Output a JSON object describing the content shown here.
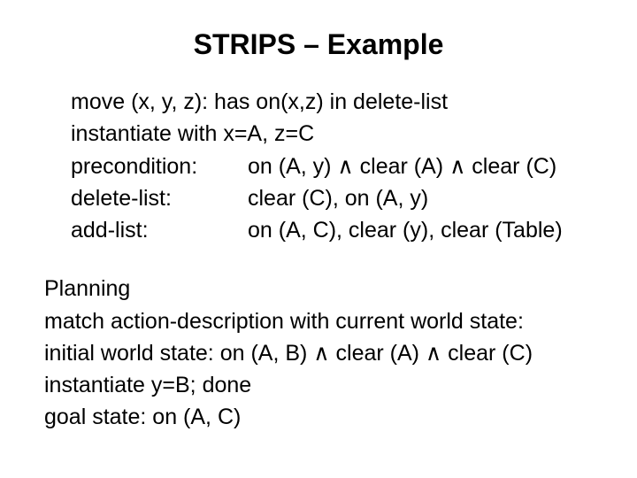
{
  "title": "STRIPS – Example",
  "block1": {
    "line1": "move (x, y, z):  has on(x,z) in delete-list",
    "line2": "instantiate with x=A, z=C",
    "precondition_label": "precondition:",
    "precondition_value": "on (A, y) ∧ clear (A) ∧ clear (C)",
    "delete_label": "delete-list:",
    "delete_value": "clear (C), on (A, y)",
    "add_label": "add-list:",
    "add_value": "on (A, C), clear (y), clear (Table)"
  },
  "block2": {
    "l1": "Planning",
    "l2": "match action-description with current world state:",
    "l3": "initial world state: on (A, B) ∧ clear (A) ∧ clear (C)",
    "l4": "instantiate y=B; done",
    "l5": "goal state: on (A, C)"
  }
}
